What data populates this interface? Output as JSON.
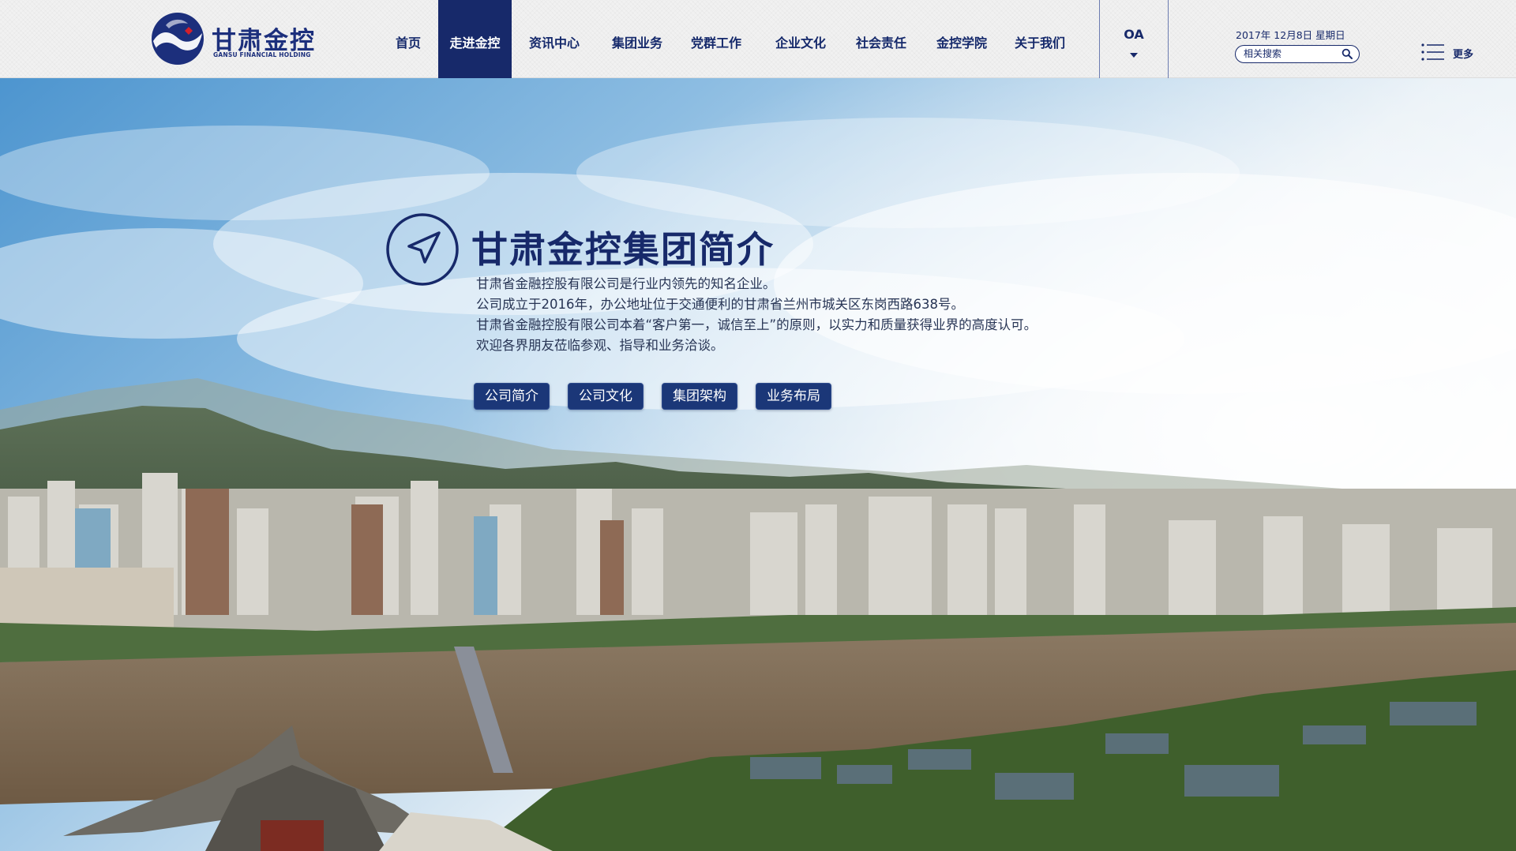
{
  "logo": {
    "name_cn": "甘肃金控",
    "name_en": "GANSU FINANCIAL HOLDING"
  },
  "nav": {
    "items": [
      {
        "label": "首页",
        "active": false
      },
      {
        "label": "走进金控",
        "active": true
      },
      {
        "label": "资讯中心",
        "active": false
      },
      {
        "label": "集团业务",
        "active": false
      },
      {
        "label": "党群工作",
        "active": false
      },
      {
        "label": "企业文化",
        "active": false
      },
      {
        "label": "社会责任",
        "active": false
      },
      {
        "label": "金控学院",
        "active": false
      },
      {
        "label": "关于我们",
        "active": false
      }
    ],
    "oa_label": "OA"
  },
  "header_right": {
    "date": "2017年 12月8日 星期日",
    "search_placeholder": "相关搜索",
    "more_label": "更多"
  },
  "intro": {
    "title": "甘肃金控集团简介",
    "lines": [
      "甘肃省金融控股有限公司是行业内领先的知名企业。",
      "公司成立于2016年，办公地址位于交通便利的甘肃省兰州市城关区东岗西路638号。",
      "甘肃省金融控股有限公司本着“客户第一，诚信至上”的原则，以实力和质量获得业界的高度认可。",
      "欢迎各界朋友莅临参观、指导和业务洽谈。"
    ],
    "buttons": [
      "公司简介",
      "公司文化",
      "集团架构",
      "业务布局"
    ]
  },
  "colors": {
    "brand_navy": "#17296a",
    "button_blue": "#1b3778",
    "logo_red": "#d4202c"
  },
  "icons": [
    "logo-mark-icon",
    "caret-down-icon",
    "search-icon",
    "menu-list-icon",
    "compass-arrow-icon"
  ]
}
